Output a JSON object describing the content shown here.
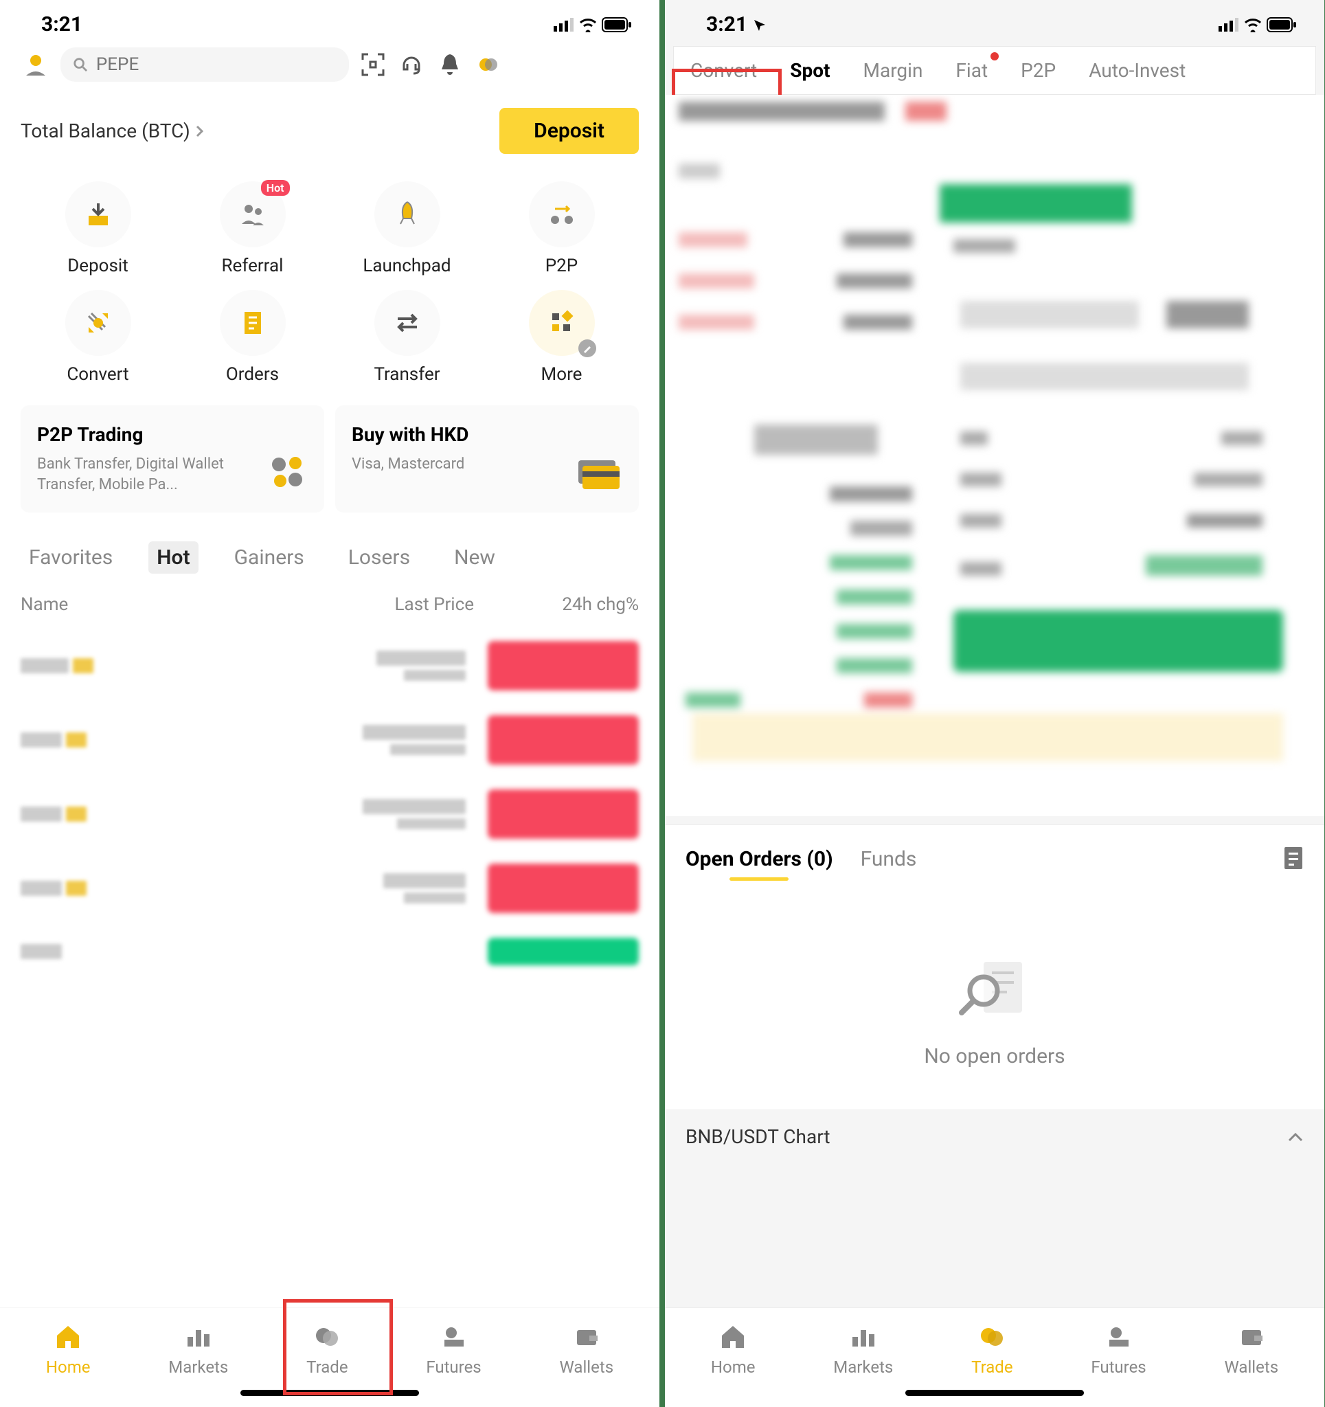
{
  "status": {
    "time": "3:21"
  },
  "left": {
    "search_placeholder": "PEPE",
    "balance_label": "Total Balance (BTC)",
    "deposit_button": "Deposit",
    "quick_actions": [
      {
        "label": "Deposit"
      },
      {
        "label": "Referral",
        "badge": "Hot"
      },
      {
        "label": "Launchpad"
      },
      {
        "label": "P2P"
      },
      {
        "label": "Convert"
      },
      {
        "label": "Orders"
      },
      {
        "label": "Transfer"
      },
      {
        "label": "More"
      }
    ],
    "cards": [
      {
        "title": "P2P Trading",
        "desc": "Bank Transfer, Digital Wallet Transfer, Mobile Pa..."
      },
      {
        "title": "Buy with HKD",
        "desc": "Visa, Mastercard"
      }
    ],
    "market_tabs": [
      "Favorites",
      "Hot",
      "Gainers",
      "Losers",
      "New"
    ],
    "market_tab_active": "Hot",
    "columns": {
      "name": "Name",
      "price": "Last Price",
      "chg": "24h chg%"
    }
  },
  "right": {
    "trade_tabs": [
      "Convert",
      "Spot",
      "Margin",
      "Fiat",
      "P2P",
      "Auto-Invest"
    ],
    "trade_tab_active": "Spot",
    "highlighted_tab": "Convert",
    "orders_tabs": {
      "open": "Open Orders (0)",
      "funds": "Funds"
    },
    "empty_text": "No open orders",
    "chart_label": "BNB/USDT Chart"
  },
  "nav": {
    "items": [
      "Home",
      "Markets",
      "Trade",
      "Futures",
      "Wallets"
    ],
    "left_active": "Home",
    "right_active": "Trade"
  }
}
